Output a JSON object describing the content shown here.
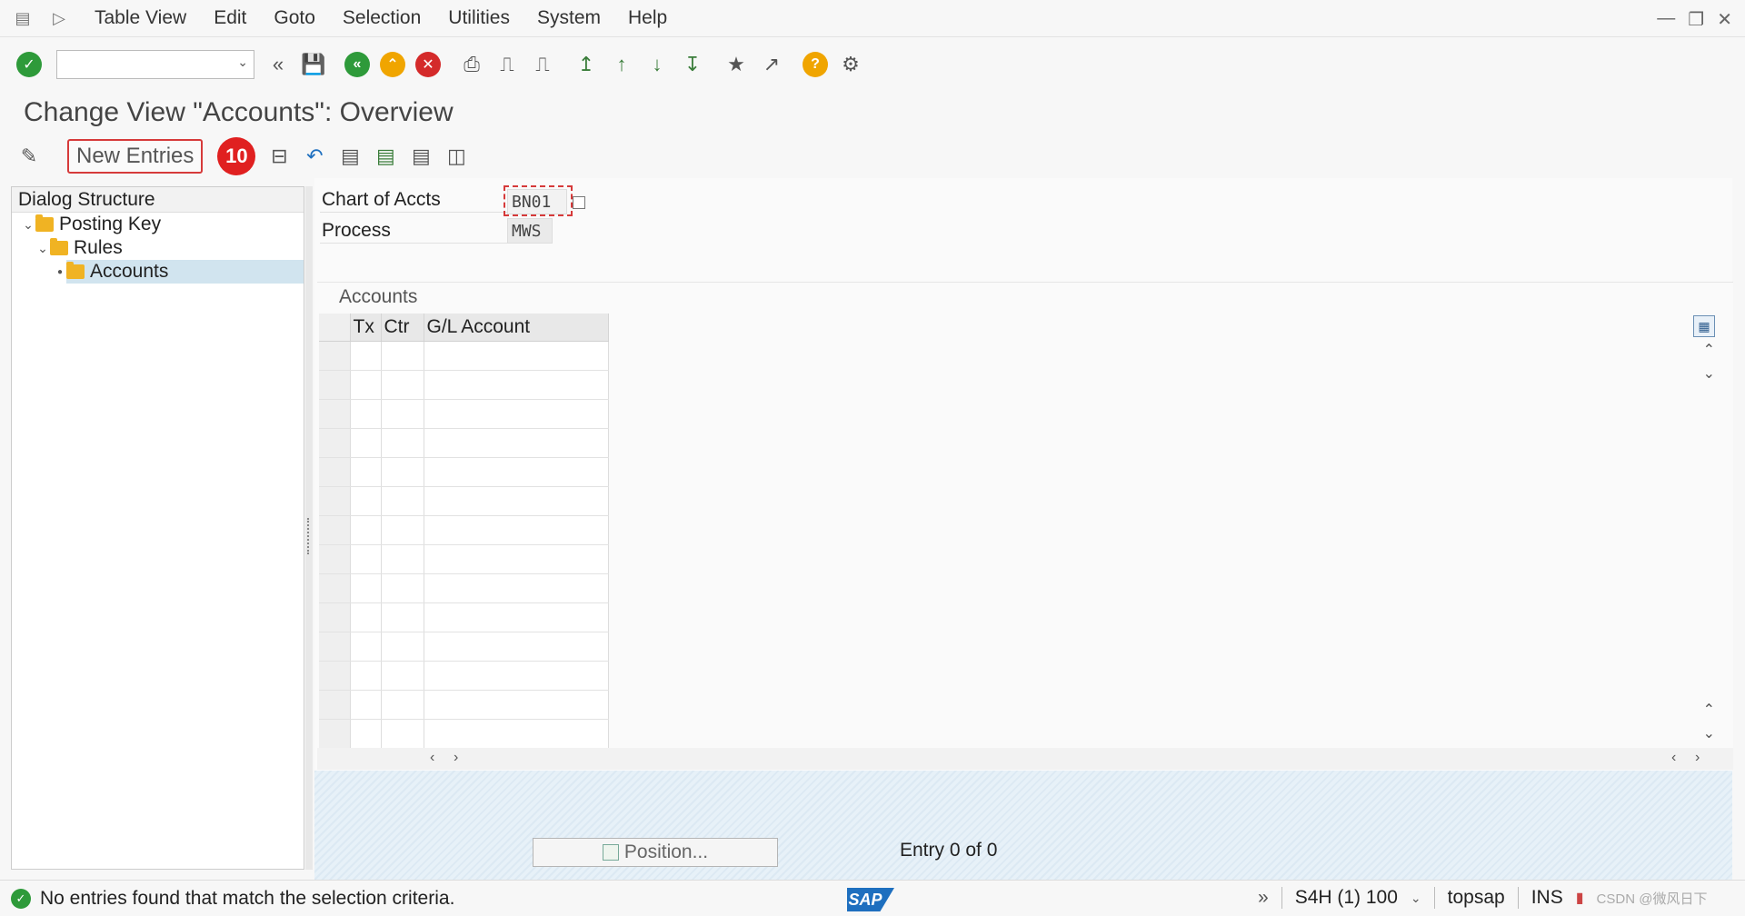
{
  "menu": {
    "items": [
      "Table View",
      "Edit",
      "Goto",
      "Selection",
      "Utilities",
      "System",
      "Help"
    ]
  },
  "toolbar": {
    "command_field_value": ""
  },
  "page_title": "Change View \"Accounts\": Overview",
  "app_toolbar": {
    "new_entries_label": "New Entries",
    "badge_number": "10"
  },
  "dialog_structure": {
    "heading": "Dialog Structure",
    "items": [
      {
        "label": "Posting Key",
        "level": 1
      },
      {
        "label": "Rules",
        "level": 2
      },
      {
        "label": "Accounts",
        "level": 3,
        "selected": true
      }
    ]
  },
  "header_fields": {
    "chart_of_accts_label": "Chart of Accts",
    "chart_of_accts_value": "BN01",
    "process_label": "Process",
    "process_value": "MWS"
  },
  "table": {
    "title": "Accounts",
    "columns": [
      "Tx",
      "Ctr",
      "G/L Account"
    ],
    "rows": []
  },
  "footer": {
    "position_button": "Position...",
    "entry_count": "Entry 0 of 0"
  },
  "status": {
    "message": "No entries found that match the selection criteria.",
    "system": "S4H (1) 100",
    "server": "topsap",
    "mode": "INS",
    "watermark": "CSDN @微风日下"
  },
  "colors": {
    "accent_red": "#d63a3a",
    "ok_green": "#2e9a3a",
    "selected_row": "#d1e4ef"
  }
}
